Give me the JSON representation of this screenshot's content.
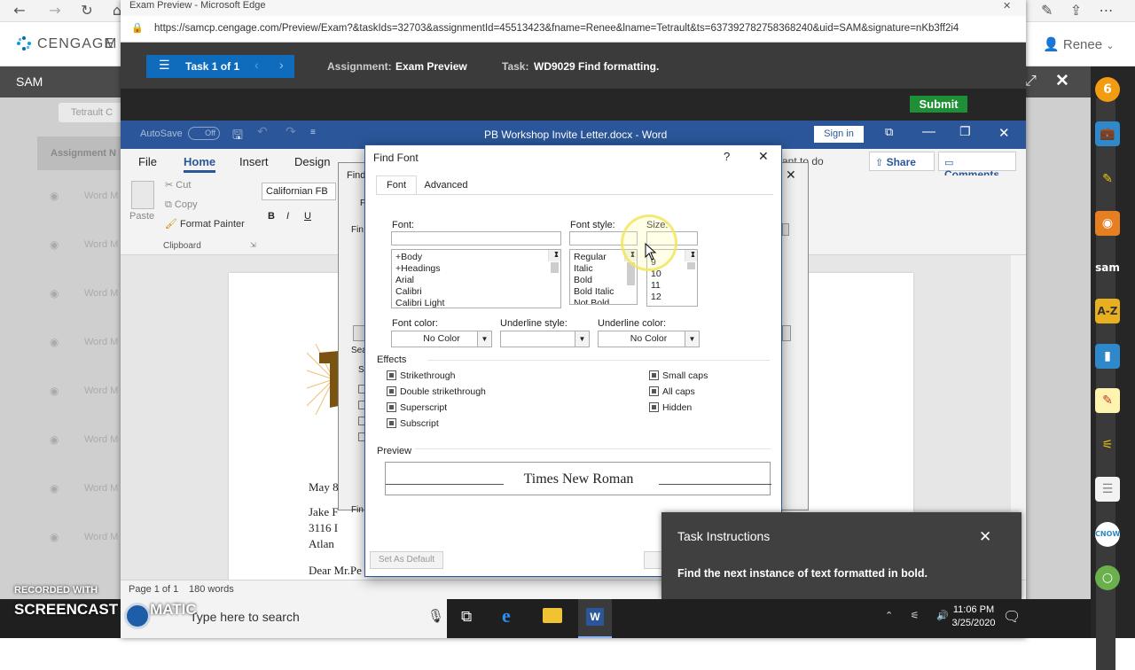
{
  "edge": {
    "window_title": "Exam Preview - Microsoft Edge",
    "url": "https://samcp.cengage.com/Preview/Exam?&taskIds=32703&assignmentId=45513423&fname=Renee&lname=Tetrault&ts=637392782758368240&uid=SAM&signature=nKb3ff2i4",
    "icons": [
      "back-icon",
      "forward-icon",
      "refresh-icon",
      "home-icon",
      "pen-icon",
      "share-icon",
      "more-icon"
    ]
  },
  "cengage": {
    "logo_text": "CENGAGE",
    "logo_suffix": "M",
    "user_name": "Renee",
    "sam_label": "SAM",
    "bg_tab": "Tetrault C",
    "bg_header": "Assignment N",
    "bg_rows": [
      "Word M",
      "Word M",
      "Word M",
      "Word M",
      "Word M",
      "Word M",
      "Word M",
      "Word M"
    ]
  },
  "exam": {
    "task_counter": "Task 1 of 1",
    "assignment_label": "Assignment:",
    "assignment_value": "Exam Preview",
    "task_label": "Task:",
    "task_value": "WD9029 Find formatting.",
    "submit_label": "Submit"
  },
  "word": {
    "autosave_label": "AutoSave",
    "autosave_state": "Off",
    "doc_title": "PB Workshop Invite Letter.docx  -  Word",
    "sign_in": "Sign in",
    "tabs": [
      "File",
      "Home",
      "Insert",
      "Design"
    ],
    "tell_me": "ant to do",
    "share": "Share",
    "comments": "Comments",
    "clipboard": {
      "paste": "Paste",
      "cut": "Cut",
      "copy": "Copy",
      "format_painter": "Format Painter",
      "group_label": "Clipboard"
    },
    "font_box": "Californian FB",
    "format_buttons": [
      "B",
      "I",
      "U"
    ],
    "status_page": "Page 1 of 1",
    "status_words": "180 words",
    "doc_lines": [
      "May 8",
      "Jake F",
      "3116 I",
      "Atlan",
      "Dear Mr.Pe"
    ]
  },
  "find_replace": {
    "title": "Find",
    "partial_labels": [
      "Fi",
      "Fin",
      "Sea",
      "Se",
      "Fin"
    ]
  },
  "find_font": {
    "title": "Find Font",
    "help": "?",
    "close": "✕",
    "tabs": [
      "Font",
      "Advanced"
    ],
    "font_label": "Font:",
    "font_value": "",
    "font_list": [
      "+Body",
      "+Headings",
      "Arial",
      "Calibri",
      "Calibri Light"
    ],
    "style_label": "Font style:",
    "style_value": "",
    "style_list": [
      "Regular",
      "Italic",
      "Bold",
      "Bold Italic",
      "Not Bold"
    ],
    "size_label": "Size:",
    "size_value": "",
    "size_list": [
      "9",
      "10",
      "11",
      "12"
    ],
    "font_color_label": "Font color:",
    "font_color_value": "No Color",
    "underline_style_label": "Underline style:",
    "underline_style_value": "",
    "underline_color_label": "Underline color:",
    "underline_color_value": "No Color",
    "effects_label": "Effects",
    "effects_left": [
      "Strikethrough",
      "Double strikethrough",
      "Superscript",
      "Subscript"
    ],
    "effects_right": [
      "Small caps",
      "All caps",
      "Hidden"
    ],
    "preview_label": "Preview",
    "preview_text": "Times New Roman",
    "set_default": "Set As Default"
  },
  "task_instructions": {
    "title": "Task Instructions",
    "text": "Find the next instance of text formatted in bold."
  },
  "taskbar": {
    "search_placeholder": "Type here to search",
    "time": "11:06 PM",
    "date": "3/25/2020"
  },
  "watermark": {
    "line1": "RECORDED WITH",
    "line2": "SCREENCAST",
    "line3": "MATIC"
  },
  "colors": {
    "word_blue": "#2b579a",
    "submit_green": "#1e8f36",
    "task_blue": "#0f6cbd"
  }
}
